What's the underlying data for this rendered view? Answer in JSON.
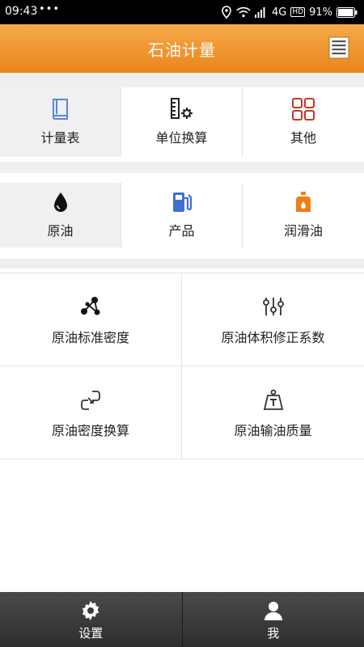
{
  "status_bar": {
    "time": "09:43",
    "dots": "•••",
    "network": "4G",
    "hd": "HD",
    "battery": "91%"
  },
  "app_bar": {
    "title": "石油计量",
    "menu_icon": "list-icon"
  },
  "top_tabs": [
    {
      "label": "计量表",
      "icon": "book-icon",
      "active": true
    },
    {
      "label": "单位换算",
      "icon": "ruler-gear-icon",
      "active": false
    },
    {
      "label": "其他",
      "icon": "grid-icon",
      "active": false
    }
  ],
  "product_tabs": [
    {
      "label": "原油",
      "icon": "oil-drop-icon",
      "active": true
    },
    {
      "label": "产品",
      "icon": "fuel-pump-icon",
      "active": false
    },
    {
      "label": "润滑油",
      "icon": "oil-can-icon",
      "active": false
    }
  ],
  "items": [
    {
      "label": "原油标准密度",
      "icon": "molecule-icon"
    },
    {
      "label": "原油体积修正系数",
      "icon": "sliders-icon"
    },
    {
      "label": "原油密度换算",
      "icon": "convert-icon"
    },
    {
      "label": "原油输油质量",
      "icon": "weight-icon"
    }
  ],
  "bottom_nav": [
    {
      "label": "设置",
      "icon": "gear-icon"
    },
    {
      "label": "我",
      "icon": "user-icon"
    }
  ],
  "colors": {
    "accent": "#ea861c",
    "blue": "#3f6fd0",
    "red": "#c0392b",
    "orange": "#ef7d1a"
  }
}
